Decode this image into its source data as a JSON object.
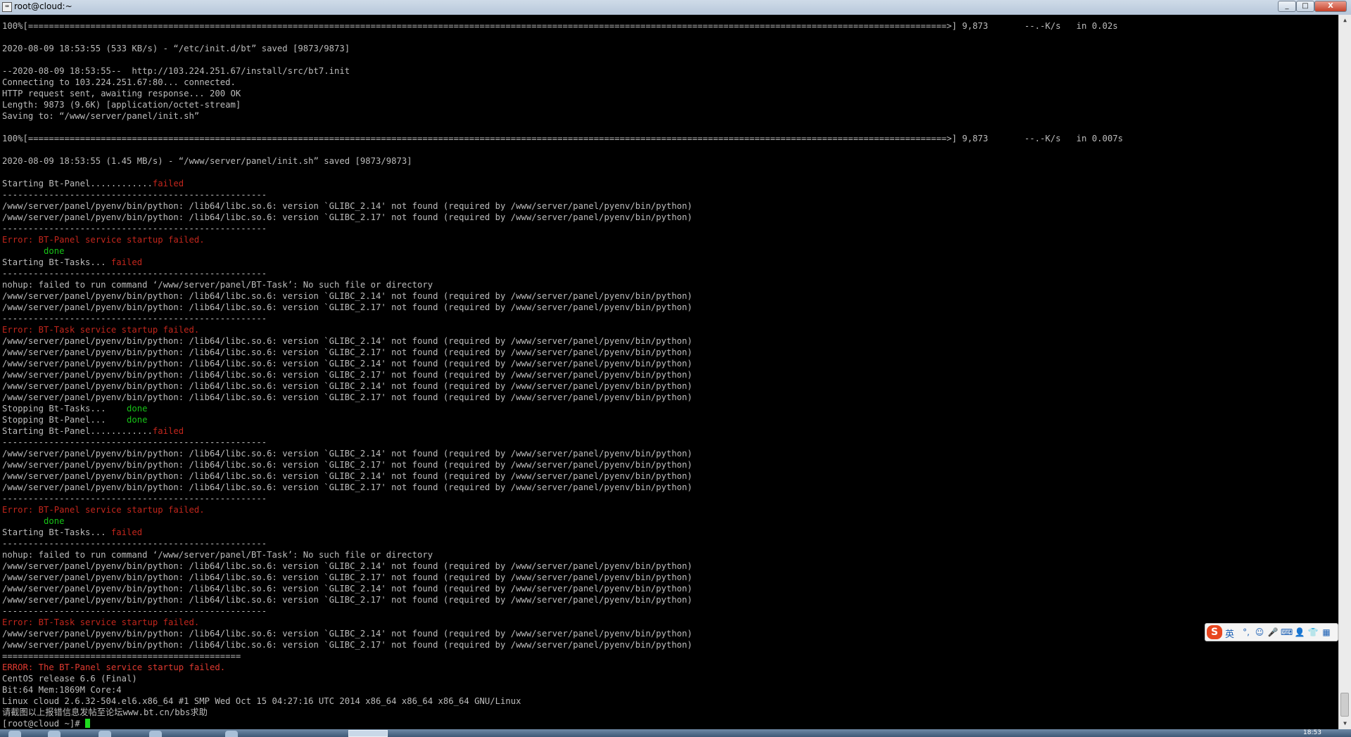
{
  "window": {
    "title": "root@cloud:~",
    "icon_glyph": "⌨",
    "controls": {
      "minimize": "_",
      "maximize": "□",
      "close": "X"
    }
  },
  "terminal": {
    "lines": [
      [
        {
          "t": "100%[=================================================================================================================================================================================>] 9,873       --.-K/s   in 0.02s"
        }
      ],
      [
        {
          "t": ""
        }
      ],
      [
        {
          "t": "2020-08-09 18:53:55 (533 KB/s) - “/etc/init.d/bt” saved [9873/9873]"
        }
      ],
      [
        {
          "t": ""
        }
      ],
      [
        {
          "t": "--2020-08-09 18:53:55--  http://103.224.251.67/install/src/bt7.init"
        }
      ],
      [
        {
          "t": "Connecting to 103.224.251.67:80... connected."
        }
      ],
      [
        {
          "t": "HTTP request sent, awaiting response... 200 OK"
        }
      ],
      [
        {
          "t": "Length: 9873 (9.6K) [application/octet-stream]"
        }
      ],
      [
        {
          "t": "Saving to: “/www/server/panel/init.sh”"
        }
      ],
      [
        {
          "t": ""
        }
      ],
      [
        {
          "t": "100%[=================================================================================================================================================================================>] 9,873       --.-K/s   in 0.007s"
        }
      ],
      [
        {
          "t": ""
        }
      ],
      [
        {
          "t": "2020-08-09 18:53:55 (1.45 MB/s) - “/www/server/panel/init.sh” saved [9873/9873]"
        }
      ],
      [
        {
          "t": ""
        }
      ],
      [
        {
          "t": "Starting Bt-Panel............"
        },
        {
          "t": "failed",
          "c": "red"
        }
      ],
      [
        {
          "t": "---------------------------------------------------"
        }
      ],
      [
        {
          "t": "/www/server/panel/pyenv/bin/python: /lib64/libc.so.6: version `GLIBC_2.14' not found (required by /www/server/panel/pyenv/bin/python)"
        }
      ],
      [
        {
          "t": "/www/server/panel/pyenv/bin/python: /lib64/libc.so.6: version `GLIBC_2.17' not found (required by /www/server/panel/pyenv/bin/python)"
        }
      ],
      [
        {
          "t": "---------------------------------------------------"
        }
      ],
      [
        {
          "t": "Error: BT-Panel service startup failed.",
          "c": "red"
        }
      ],
      [
        {
          "t": "        "
        },
        {
          "t": "done",
          "c": "green"
        }
      ],
      [
        {
          "t": "Starting Bt-Tasks... "
        },
        {
          "t": "failed",
          "c": "red"
        }
      ],
      [
        {
          "t": "---------------------------------------------------"
        }
      ],
      [
        {
          "t": "nohup: failed to run command ‘/www/server/panel/BT-Task’: No such file or directory"
        }
      ],
      [
        {
          "t": "/www/server/panel/pyenv/bin/python: /lib64/libc.so.6: version `GLIBC_2.14' not found (required by /www/server/panel/pyenv/bin/python)"
        }
      ],
      [
        {
          "t": "/www/server/panel/pyenv/bin/python: /lib64/libc.so.6: version `GLIBC_2.17' not found (required by /www/server/panel/pyenv/bin/python)"
        }
      ],
      [
        {
          "t": "---------------------------------------------------"
        }
      ],
      [
        {
          "t": "Error: BT-Task service startup failed.",
          "c": "red"
        }
      ],
      [
        {
          "t": "/www/server/panel/pyenv/bin/python: /lib64/libc.so.6: version `GLIBC_2.14' not found (required by /www/server/panel/pyenv/bin/python)"
        }
      ],
      [
        {
          "t": "/www/server/panel/pyenv/bin/python: /lib64/libc.so.6: version `GLIBC_2.17' not found (required by /www/server/panel/pyenv/bin/python)"
        }
      ],
      [
        {
          "t": "/www/server/panel/pyenv/bin/python: /lib64/libc.so.6: version `GLIBC_2.14' not found (required by /www/server/panel/pyenv/bin/python)"
        }
      ],
      [
        {
          "t": "/www/server/panel/pyenv/bin/python: /lib64/libc.so.6: version `GLIBC_2.17' not found (required by /www/server/panel/pyenv/bin/python)"
        }
      ],
      [
        {
          "t": "/www/server/panel/pyenv/bin/python: /lib64/libc.so.6: version `GLIBC_2.14' not found (required by /www/server/panel/pyenv/bin/python)"
        }
      ],
      [
        {
          "t": "/www/server/panel/pyenv/bin/python: /lib64/libc.so.6: version `GLIBC_2.17' not found (required by /www/server/panel/pyenv/bin/python)"
        }
      ],
      [
        {
          "t": "Stopping Bt-Tasks...    "
        },
        {
          "t": "done",
          "c": "green"
        }
      ],
      [
        {
          "t": "Stopping Bt-Panel...    "
        },
        {
          "t": "done",
          "c": "green"
        }
      ],
      [
        {
          "t": "Starting Bt-Panel............"
        },
        {
          "t": "failed",
          "c": "red"
        }
      ],
      [
        {
          "t": "---------------------------------------------------"
        }
      ],
      [
        {
          "t": "/www/server/panel/pyenv/bin/python: /lib64/libc.so.6: version `GLIBC_2.14' not found (required by /www/server/panel/pyenv/bin/python)"
        }
      ],
      [
        {
          "t": "/www/server/panel/pyenv/bin/python: /lib64/libc.so.6: version `GLIBC_2.17' not found (required by /www/server/panel/pyenv/bin/python)"
        }
      ],
      [
        {
          "t": "/www/server/panel/pyenv/bin/python: /lib64/libc.so.6: version `GLIBC_2.14' not found (required by /www/server/panel/pyenv/bin/python)"
        }
      ],
      [
        {
          "t": "/www/server/panel/pyenv/bin/python: /lib64/libc.so.6: version `GLIBC_2.17' not found (required by /www/server/panel/pyenv/bin/python)"
        }
      ],
      [
        {
          "t": "---------------------------------------------------"
        }
      ],
      [
        {
          "t": "Error: BT-Panel service startup failed.",
          "c": "red"
        }
      ],
      [
        {
          "t": "        "
        },
        {
          "t": "done",
          "c": "green"
        }
      ],
      [
        {
          "t": "Starting Bt-Tasks... "
        },
        {
          "t": "failed",
          "c": "red"
        }
      ],
      [
        {
          "t": "---------------------------------------------------"
        }
      ],
      [
        {
          "t": "nohup: failed to run command ‘/www/server/panel/BT-Task’: No such file or directory"
        }
      ],
      [
        {
          "t": "/www/server/panel/pyenv/bin/python: /lib64/libc.so.6: version `GLIBC_2.14' not found (required by /www/server/panel/pyenv/bin/python)"
        }
      ],
      [
        {
          "t": "/www/server/panel/pyenv/bin/python: /lib64/libc.so.6: version `GLIBC_2.17' not found (required by /www/server/panel/pyenv/bin/python)"
        }
      ],
      [
        {
          "t": "/www/server/panel/pyenv/bin/python: /lib64/libc.so.6: version `GLIBC_2.14' not found (required by /www/server/panel/pyenv/bin/python)"
        }
      ],
      [
        {
          "t": "/www/server/panel/pyenv/bin/python: /lib64/libc.so.6: version `GLIBC_2.17' not found (required by /www/server/panel/pyenv/bin/python)"
        }
      ],
      [
        {
          "t": "---------------------------------------------------"
        }
      ],
      [
        {
          "t": "Error: BT-Task service startup failed.",
          "c": "red"
        }
      ],
      [
        {
          "t": "/www/server/panel/pyenv/bin/python: /lib64/libc.so.6: version `GLIBC_2.14' not found (required by /www/server/panel/pyenv/bin/python)"
        }
      ],
      [
        {
          "t": "/www/server/panel/pyenv/bin/python: /lib64/libc.so.6: version `GLIBC_2.17' not found (required by /www/server/panel/pyenv/bin/python)"
        }
      ],
      [
        {
          "t": "=============================================="
        }
      ],
      [
        {
          "t": "ERROR: The BT-Panel service startup failed.",
          "c": "bred"
        }
      ],
      [
        {
          "t": "CentOS release 6.6 (Final)"
        }
      ],
      [
        {
          "t": "Bit:64 Mem:1869M Core:4"
        }
      ],
      [
        {
          "t": "Linux cloud 2.6.32-504.el6.x86_64 #1 SMP Wed Oct 15 04:27:16 UTC 2014 x86_64 x86_64 x86_64 GNU/Linux"
        }
      ],
      [
        {
          "t": "请截图以上报错信息发帖至论坛www.bt.cn/bbs求助"
        }
      ],
      [
        {
          "t": "[root@cloud ~]# "
        },
        {
          "cursor": true
        }
      ]
    ]
  },
  "scrollbar": {
    "up_glyph": "▲",
    "down_glyph": "▼"
  },
  "ime_toolbar": {
    "logo": "S",
    "language": "英",
    "tools": [
      {
        "name": "punctuation-icon",
        "glyph": "°,"
      },
      {
        "name": "emoji-icon",
        "glyph": "☺"
      },
      {
        "name": "microphone-icon",
        "glyph": "🎤"
      },
      {
        "name": "keyboard-icon",
        "glyph": "⌨"
      },
      {
        "name": "user-icon",
        "glyph": "👤"
      },
      {
        "name": "skin-icon",
        "glyph": "👕"
      },
      {
        "name": "grid-icon",
        "glyph": "▦"
      }
    ]
  },
  "colors": {
    "terminal_bg": "#000000",
    "terminal_fg": "#bcbcbc",
    "error_red": "#c3261c",
    "ok_green": "#17c217",
    "cursor_green": "#1fdc1f",
    "ime_brand": "#e8461f"
  },
  "taskbar": {
    "clock": "18:53"
  }
}
